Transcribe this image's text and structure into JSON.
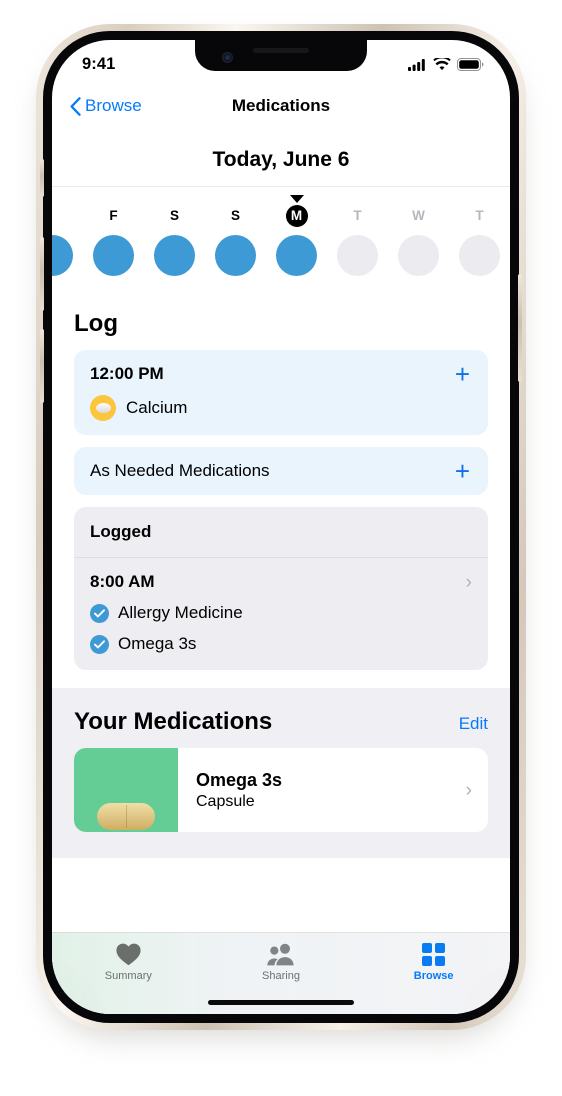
{
  "status_bar": {
    "time": "9:41",
    "icons": [
      "cellular-signal-icon",
      "wifi-icon",
      "battery-icon"
    ]
  },
  "nav": {
    "back_label": "Browse",
    "back_icon": "chevron-left-icon",
    "title": "Medications"
  },
  "date_header": {
    "title": "Today, June 6"
  },
  "day_strip": {
    "caret_icon": "triangle-down-pointer",
    "days": [
      {
        "letter": "F",
        "state": "past",
        "dot": "filled"
      },
      {
        "letter": "S",
        "state": "past",
        "dot": "filled"
      },
      {
        "letter": "S",
        "state": "past",
        "dot": "filled"
      },
      {
        "letter": "M",
        "state": "today",
        "dot": "filled"
      },
      {
        "letter": "T",
        "state": "future",
        "dot": "empty"
      },
      {
        "letter": "W",
        "state": "future",
        "dot": "empty"
      },
      {
        "letter": "T",
        "state": "future",
        "dot": "empty"
      }
    ]
  },
  "log": {
    "title": "Log",
    "scheduled": {
      "time": "12:00 PM",
      "add_icon": "plus-icon",
      "medication": "Calcium",
      "medication_icon": "tablet-pill-icon"
    },
    "as_needed": {
      "label": "As Needed Medications",
      "add_icon": "plus-icon"
    },
    "logged": {
      "header": "Logged",
      "time": "8:00 AM",
      "chevron_icon": "chevron-right-icon",
      "items": [
        {
          "name": "Allergy Medicine",
          "icon": "check-circle-icon"
        },
        {
          "name": "Omega 3s",
          "icon": "check-circle-icon"
        }
      ]
    }
  },
  "your_medications": {
    "title": "Your Medications",
    "edit_label": "Edit",
    "items": [
      {
        "name": "Omega 3s",
        "form": "Capsule",
        "thumb_color": "#63cd95",
        "thumb_icon": "capsule-icon",
        "chevron_icon": "chevron-right-icon"
      }
    ]
  },
  "tab_bar": {
    "tabs": [
      {
        "label": "Summary",
        "icon": "heart-icon",
        "active": false
      },
      {
        "label": "Sharing",
        "icon": "people-icon",
        "active": false
      },
      {
        "label": "Browse",
        "icon": "grid-icon",
        "active": true
      }
    ]
  },
  "colors": {
    "accent_blue": "#067bf7",
    "day_dot_blue": "#3e9ad4",
    "card_blue": "#e9f4fd",
    "card_gray": "#eeeef2",
    "section_bg": "#f0f0f4",
    "pill_yellow": "#fcc63c",
    "thumb_green": "#63cd95"
  }
}
